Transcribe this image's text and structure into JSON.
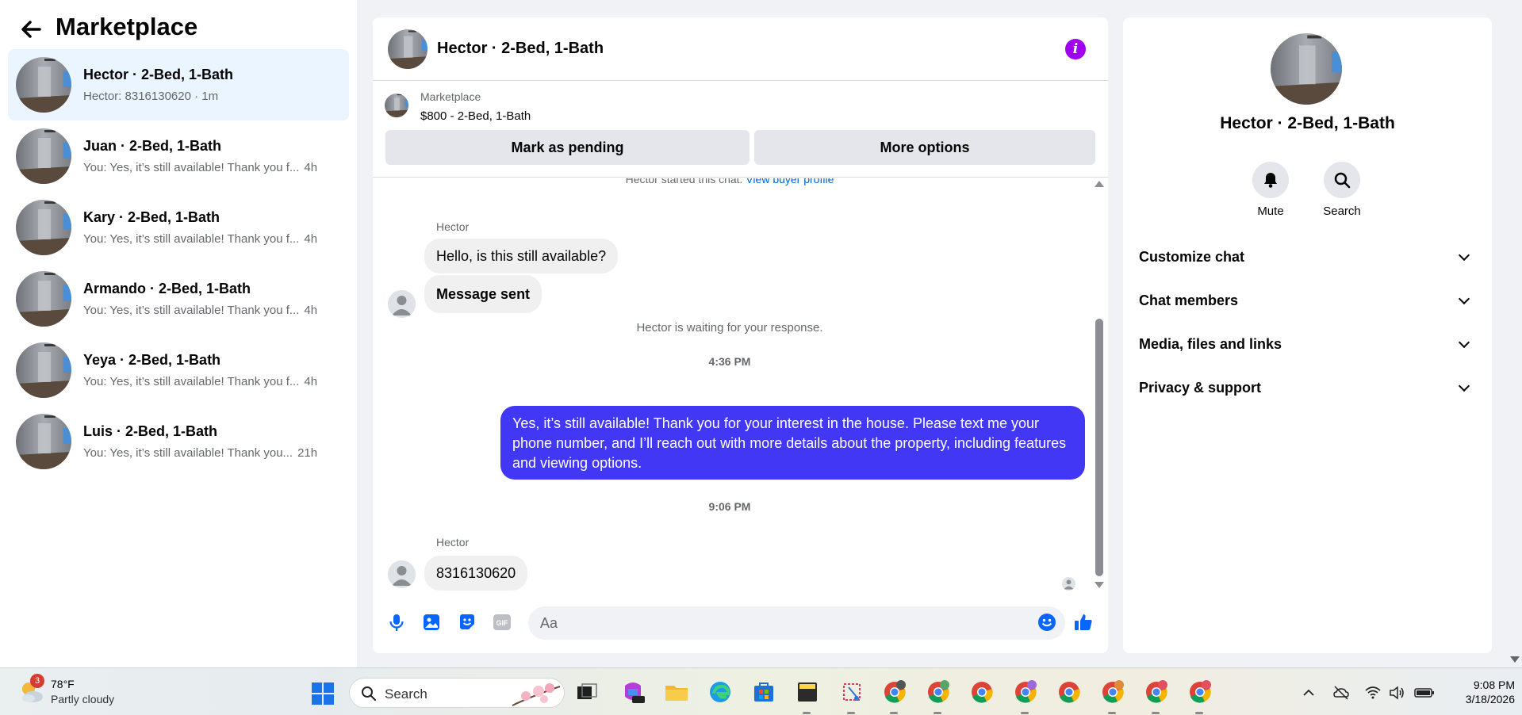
{
  "sidebar": {
    "title": "Marketplace",
    "conversations": [
      {
        "name": "Hector · 2-Bed, 1-Bath",
        "preview": "Hector: 8316130620 · 1m",
        "time": ""
      },
      {
        "name": "Juan · 2-Bed, 1-Bath",
        "preview": "You: Yes, it’s still available! Thank you f...",
        "time": "4h"
      },
      {
        "name": "Kary · 2-Bed, 1-Bath",
        "preview": "You: Yes, it’s still available! Thank you f...",
        "time": "4h"
      },
      {
        "name": "Armando · 2-Bed, 1-Bath",
        "preview": "You: Yes, it’s still available! Thank you f...",
        "time": "4h"
      },
      {
        "name": "Yeya · 2-Bed, 1-Bath",
        "preview": "You: Yes, it’s still available! Thank you f...",
        "time": "4h"
      },
      {
        "name": "Luis · 2-Bed, 1-Bath",
        "preview": "You: Yes, it’s still available! Thank you...",
        "time": "21h"
      }
    ]
  },
  "chat": {
    "title": "Hector · 2-Bed, 1-Bath",
    "listing_source": "Marketplace",
    "listing_price": "$800 - 2-Bed, 1-Bath",
    "mark_pending": "Mark as pending",
    "more_options": "More options",
    "started_text": "Hector started this chat.",
    "started_link": "View buyer profile",
    "sender_1": "Hector",
    "msg_1": "Hello, is this still available?",
    "msg_2": "Message sent",
    "waiting": "Hector is waiting for your response.",
    "time_1": "4:36 PM",
    "msg_out": "Yes, it’s still available! Thank you for your interest in the house. Please text me your phone number, and I’ll reach out with more details about the property, including features and viewing options.",
    "time_2": "9:06 PM",
    "sender_2": "Hector",
    "msg_3": "8316130620",
    "composer_placeholder": "Aa"
  },
  "details": {
    "name": "Hector · 2-Bed, 1-Bath",
    "mute": "Mute",
    "search": "Search",
    "sections": [
      "Customize chat",
      "Chat members",
      "Media, files and links",
      "Privacy & support"
    ]
  },
  "taskbar": {
    "weather_badge": "3",
    "temp": "78°F",
    "condition": "Partly cloudy",
    "search": "Search",
    "time": "9:08 PM",
    "date": "3/18/2026"
  },
  "colors": {
    "accent": "#0866ff",
    "outgoing_bubble": "#4237f5",
    "info": "#a000f0",
    "active_conversation": "#ebf5ff"
  }
}
